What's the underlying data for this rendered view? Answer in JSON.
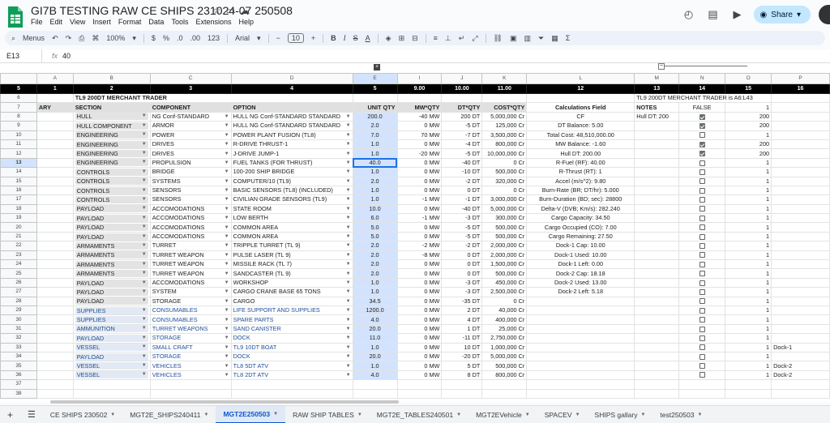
{
  "title": "GI7B TESTING RAW CE SHIPS 231024-07 250508",
  "menu": [
    "File",
    "Edit",
    "View",
    "Insert",
    "Format",
    "Data",
    "Tools",
    "Extensions",
    "Help"
  ],
  "share_label": "Share",
  "toolbar": {
    "menus": "Menus",
    "zoom": "100%",
    "currency": "$",
    "percent": "%",
    "dec_less": ".0",
    "dec_more": ".00",
    "num_format": "123",
    "font": "Arial",
    "font_size": "10"
  },
  "formula_bar": {
    "cell_ref": "E13",
    "value": "40"
  },
  "columns": [
    "",
    "A",
    "B",
    "C",
    "D",
    "E",
    "I",
    "J",
    "K",
    "L",
    "M",
    "N",
    "O",
    "P"
  ],
  "numbers_row": {
    "row": "5",
    "values": [
      "1",
      "2",
      "3",
      "4",
      "5",
      "9.00",
      "10.00",
      "11.00",
      "12",
      "13",
      "14",
      "15",
      "16"
    ]
  },
  "title_row": {
    "row": "6",
    "text": "TL9 200DT MERCHANT TRADER",
    "m_text": "TL9 200DT MERCHANT TRADER is A6:L43"
  },
  "header_row": {
    "row": "7",
    "a": "ARY",
    "section": "SECTION",
    "component": "COMPONENT",
    "option": "OPTION",
    "unit": "UNIT QTY",
    "mw": "MW*QTY",
    "dt": "DT*QTY",
    "cost": "COST*QTY",
    "calc": "Calculations Field",
    "notes": "NOTES",
    "n": "FALSE",
    "o": "1"
  },
  "rows": [
    {
      "r": "8",
      "sec": "HULL",
      "comp": "NG Conf-STANDARD",
      "opt": "HULL NG Conf-STANDARD STANDARD",
      "unit": "200.0",
      "mw": "-40",
      "mwu": "MW",
      "dt": "200",
      "dtu": "DT",
      "cost": "5,000,000",
      "cu": "Cr",
      "calc": "CF",
      "notes": "Hull DT: 200",
      "chk": true,
      "o": "200",
      "p": "",
      "blue": false
    },
    {
      "r": "9",
      "sec": "HULL COMPONENT",
      "comp": "ARMOR",
      "opt": "HULL NG Conf-STANDARD STANDARD",
      "unit": "2.0",
      "mw": "0",
      "mwu": "MW",
      "dt": "-5",
      "dtu": "DT",
      "cost": "125,000",
      "cu": "Cr",
      "calc": "DT Balance: 5.00",
      "notes": "",
      "chk": true,
      "o": "200",
      "p": "",
      "blue": false
    },
    {
      "r": "10",
      "sec": "ENGINEERING",
      "comp": "POWER",
      "opt": "POWER PLANT FUSION (TL8)",
      "unit": "7.0",
      "mw": "70",
      "mwu": "MW",
      "dt": "-7",
      "dtu": "DT",
      "cost": "3,500,000",
      "cu": "Cr",
      "calc": "Total Cost: 48,510,000.00",
      "notes": "",
      "chk": false,
      "o": "1",
      "p": "",
      "blue": false
    },
    {
      "r": "11",
      "sec": "ENGINEERING",
      "comp": "DRIVES",
      "opt": "R-DRIVE THRUST-1",
      "unit": "1.0",
      "mw": "0",
      "mwu": "MW",
      "dt": "-4",
      "dtu": "DT",
      "cost": "800,000",
      "cu": "Cr",
      "calc": "MW Balance: -1.60",
      "notes": "",
      "chk": true,
      "o": "200",
      "p": "",
      "blue": false
    },
    {
      "r": "12",
      "sec": "ENGINEERING",
      "comp": "DRIVES",
      "opt": "J-DRIVE JUMP-1",
      "unit": "1.0",
      "mw": "-20",
      "mwu": "MW",
      "dt": "-5",
      "dtu": "DT",
      "cost": "10,000,000",
      "cu": "Cr",
      "calc": "Hull DT: 200.00",
      "notes": "",
      "chk": true,
      "o": "200",
      "p": "",
      "blue": false
    },
    {
      "r": "13",
      "sec": "ENGINEERING",
      "comp": "PROPULSION",
      "opt": "FUEL TANKS (FOR THRUST)",
      "unit": "40.0",
      "mw": "0",
      "mwu": "MW",
      "dt": "-40",
      "dtu": "DT",
      "cost": "0",
      "cu": "Cr",
      "calc": "R-Fuel (RF): 40.00",
      "notes": "",
      "chk": false,
      "o": "1",
      "p": "",
      "blue": false
    },
    {
      "r": "14",
      "sec": "CONTROLS",
      "comp": "BRIDGE",
      "opt": "100-200 SHIP BRIDGE",
      "unit": "1.0",
      "mw": "0",
      "mwu": "MW",
      "dt": "-10",
      "dtu": "DT",
      "cost": "500,000",
      "cu": "Cr",
      "calc": "R-Thrust (RT): 1",
      "notes": "",
      "chk": false,
      "o": "1",
      "p": "",
      "blue": false
    },
    {
      "r": "15",
      "sec": "CONTROLS",
      "comp": "SYSTEMS",
      "opt": "COMPUTER/10 (TL9)",
      "unit": "2.0",
      "mw": "0",
      "mwu": "MW",
      "dt": "-2",
      "dtu": "DT",
      "cost": "320,000",
      "cu": "Cr",
      "calc": "Accel (m/s^2): 9.80",
      "notes": "",
      "chk": false,
      "o": "1",
      "p": "",
      "blue": false
    },
    {
      "r": "16",
      "sec": "CONTROLS",
      "comp": "SENSORS",
      "opt": "BASIC SENSORS (TL8) (INCLUDED)",
      "unit": "1.0",
      "mw": "0",
      "mwu": "MW",
      "dt": "0",
      "dtu": "DT",
      "cost": "0",
      "cu": "Cr",
      "calc": "Burn-Rate (BR; DT/hr): 5.000",
      "notes": "",
      "chk": false,
      "o": "1",
      "p": "",
      "blue": false
    },
    {
      "r": "17",
      "sec": "CONTROLS",
      "comp": "SENSORS",
      "opt": "CIVILIAN GRADE SENSORS (TL9)",
      "unit": "1.0",
      "mw": "-1",
      "mwu": "MW",
      "dt": "-1",
      "dtu": "DT",
      "cost": "3,000,000",
      "cu": "Cr",
      "calc": "Burn-Duration (BD; sec): 28800",
      "notes": "",
      "chk": false,
      "o": "1",
      "p": "",
      "blue": false
    },
    {
      "r": "18",
      "sec": "PAYLOAD",
      "comp": "ACCOMODATIONS",
      "opt": "STATE ROOM",
      "unit": "10.0",
      "mw": "0",
      "mwu": "MW",
      "dt": "-40",
      "dtu": "DT",
      "cost": "5,000,000",
      "cu": "Cr",
      "calc": "Delta-V (DVB; Km/s): 282.240",
      "notes": "",
      "chk": false,
      "o": "1",
      "p": "",
      "blue": false
    },
    {
      "r": "19",
      "sec": "PAYLOAD",
      "comp": "ACCOMODATIONS",
      "opt": "LOW BERTH",
      "unit": "6.0",
      "mw": "-1",
      "mwu": "MW",
      "dt": "-3",
      "dtu": "DT",
      "cost": "300,000",
      "cu": "Cr",
      "calc": "Cargo Capacity: 34.50",
      "notes": "",
      "chk": false,
      "o": "1",
      "p": "",
      "blue": false
    },
    {
      "r": "20",
      "sec": "PAYLOAD",
      "comp": "ACCOMODATIONS",
      "opt": "COMMON AREA",
      "unit": "5.0",
      "mw": "0",
      "mwu": "MW",
      "dt": "-5",
      "dtu": "DT",
      "cost": "500,000",
      "cu": "Cr",
      "calc": "Cargo Occupied (CO): 7.00",
      "notes": "",
      "chk": false,
      "o": "1",
      "p": "",
      "blue": false
    },
    {
      "r": "21",
      "sec": "PAYLOAD",
      "comp": "ACCOMODATIONS",
      "opt": "COMMON AREA",
      "unit": "5.0",
      "mw": "0",
      "mwu": "MW",
      "dt": "-5",
      "dtu": "DT",
      "cost": "500,000",
      "cu": "Cr",
      "calc": "Cargo Remaining: 27.50",
      "notes": "",
      "chk": false,
      "o": "1",
      "p": "",
      "blue": false
    },
    {
      "r": "22",
      "sec": "ARMAMENTS",
      "comp": "TURRET",
      "opt": "TRIPPLE TURRET (TL 9)",
      "unit": "2.0",
      "mw": "-2",
      "mwu": "MW",
      "dt": "-2",
      "dtu": "DT",
      "cost": "2,000,000",
      "cu": "Cr",
      "calc": "Dock-1 Cap: 10.00",
      "notes": "",
      "chk": false,
      "o": "1",
      "p": "",
      "blue": false
    },
    {
      "r": "23",
      "sec": "ARMAMENTS",
      "comp": "TURRET WEAPON",
      "opt": "PULSE LASER (TL 9)",
      "unit": "2.0",
      "mw": "-8",
      "mwu": "MW",
      "dt": "0",
      "dtu": "DT",
      "cost": "2,000,000",
      "cu": "Cr",
      "calc": "Dock-1 Used: 10.00",
      "notes": "",
      "chk": false,
      "o": "1",
      "p": "",
      "blue": false
    },
    {
      "r": "24",
      "sec": "ARMAMENTS",
      "comp": "TURRET WEAPON",
      "opt": "MISSILE RACK (TL 7)",
      "unit": "2.0",
      "mw": "0",
      "mwu": "MW",
      "dt": "0",
      "dtu": "DT",
      "cost": "1,500,000",
      "cu": "Cr",
      "calc": "Dock-1 Left: 0.00",
      "notes": "",
      "chk": false,
      "o": "1",
      "p": "",
      "blue": false
    },
    {
      "r": "25",
      "sec": "ARMAMENTS",
      "comp": "TURRET WEAPON",
      "opt": "SANDCASTER (TL 9)",
      "unit": "2.0",
      "mw": "0",
      "mwu": "MW",
      "dt": "0",
      "dtu": "DT",
      "cost": "500,000",
      "cu": "Cr",
      "calc": "Dock-2 Cap: 18.18",
      "notes": "",
      "chk": false,
      "o": "1",
      "p": "",
      "blue": false
    },
    {
      "r": "26",
      "sec": "PAYLOAD",
      "comp": "ACCOMODATIONS",
      "opt": "WORKSHOP",
      "unit": "1.0",
      "mw": "0",
      "mwu": "MW",
      "dt": "-3",
      "dtu": "DT",
      "cost": "450,000",
      "cu": "Cr",
      "calc": "Dock-2 Used: 13.00",
      "notes": "",
      "chk": false,
      "o": "1",
      "p": "",
      "blue": false
    },
    {
      "r": "27",
      "sec": "PAYLOAD",
      "comp": "SYSTEM",
      "opt": "CARGO CRANE BASE 65 TONS",
      "unit": "1.0",
      "mw": "0",
      "mwu": "MW",
      "dt": "-3",
      "dtu": "DT",
      "cost": "2,500,000",
      "cu": "Cr",
      "calc": "Dock-2 Left: 5.18",
      "notes": "",
      "chk": false,
      "o": "1",
      "p": "",
      "blue": false
    },
    {
      "r": "28",
      "sec": "PAYLOAD",
      "comp": "STORAGE",
      "opt": "CARGO",
      "unit": "34.5",
      "mw": "0",
      "mwu": "MW",
      "dt": "-35",
      "dtu": "DT",
      "cost": "0",
      "cu": "Cr",
      "calc": "",
      "notes": "",
      "chk": false,
      "o": "1",
      "p": "",
      "blue": false
    },
    {
      "r": "29",
      "sec": "SUPPLIES",
      "comp": "CONSUMABLES",
      "opt": "LIFE SUPPORT AND SUPPLIES",
      "unit": "1200.0",
      "mw": "0",
      "mwu": "MW",
      "dt": "2",
      "dtu": "DT",
      "cost": "40,000",
      "cu": "Cr",
      "calc": "",
      "notes": "",
      "chk": false,
      "o": "1",
      "p": "",
      "blue": true
    },
    {
      "r": "30",
      "sec": "SUPPLIES",
      "comp": "CONSUMABLES",
      "opt": "SPARE PARTS",
      "unit": "4.0",
      "mw": "0",
      "mwu": "MW",
      "dt": "4",
      "dtu": "DT",
      "cost": "400,000",
      "cu": "Cr",
      "calc": "",
      "notes": "",
      "chk": false,
      "o": "1",
      "p": "",
      "blue": true
    },
    {
      "r": "31",
      "sec": "AMMUNITION",
      "comp": "TURRET WEAPONS",
      "opt": "SAND CANISTER",
      "unit": "20.0",
      "mw": "0",
      "mwu": "MW",
      "dt": "1",
      "dtu": "DT",
      "cost": "25,000",
      "cu": "Cr",
      "calc": "",
      "notes": "",
      "chk": false,
      "o": "1",
      "p": "",
      "blue": true
    },
    {
      "r": "32",
      "sec": "PAYLOAD",
      "comp": "STORAGE",
      "opt": "DOCK",
      "unit": "11.0",
      "mw": "0",
      "mwu": "MW",
      "dt": "-11",
      "dtu": "DT",
      "cost": "2,750,000",
      "cu": "Cr",
      "calc": "",
      "notes": "",
      "chk": false,
      "o": "1",
      "p": "",
      "blue": true
    },
    {
      "r": "33",
      "sec": "VESSEL",
      "comp": "SMALL CRAFT",
      "opt": "TL9 10DT BOAT",
      "unit": "1.0",
      "mw": "0",
      "mwu": "MW",
      "dt": "10",
      "dtu": "DT",
      "cost": "1,000,000",
      "cu": "Cr",
      "calc": "",
      "notes": "",
      "chk": false,
      "o": "1",
      "p": "Dock-1",
      "blue": true
    },
    {
      "r": "34",
      "sec": "PAYLOAD",
      "comp": "STORAGE",
      "opt": "DOCK",
      "unit": "20.0",
      "mw": "0",
      "mwu": "MW",
      "dt": "-20",
      "dtu": "DT",
      "cost": "5,000,000",
      "cu": "Cr",
      "calc": "",
      "notes": "",
      "chk": false,
      "o": "1",
      "p": "",
      "blue": true
    },
    {
      "r": "35",
      "sec": "VESSEL",
      "comp": "VEHICLES",
      "opt": "TL8 5DT ATV",
      "unit": "1.0",
      "mw": "0",
      "mwu": "MW",
      "dt": "5",
      "dtu": "DT",
      "cost": "500,000",
      "cu": "Cr",
      "calc": "",
      "notes": "",
      "chk": false,
      "o": "1",
      "p": "Dock-2",
      "blue": true
    },
    {
      "r": "36",
      "sec": "VESSEL",
      "comp": "VEHICLES",
      "opt": "TL8 2DT ATV",
      "unit": "4.0",
      "mw": "0",
      "mwu": "MW",
      "dt": "8",
      "dtu": "DT",
      "cost": "800,000",
      "cu": "Cr",
      "calc": "",
      "notes": "",
      "chk": false,
      "o": "1",
      "p": "Dock-2",
      "blue": true
    }
  ],
  "empty_rows": [
    "37",
    "38"
  ],
  "tabs": [
    "CE SHIPS 230502",
    "MGT2E_SHIPS240411",
    "MGT2E250503",
    "RAW SHIP TABLES",
    "MGT2E_TABLES240501",
    "MGT2EVehicle",
    "SPACEV",
    "SHIPS gallary",
    "test250503"
  ],
  "active_tab": "MGT2E250503"
}
